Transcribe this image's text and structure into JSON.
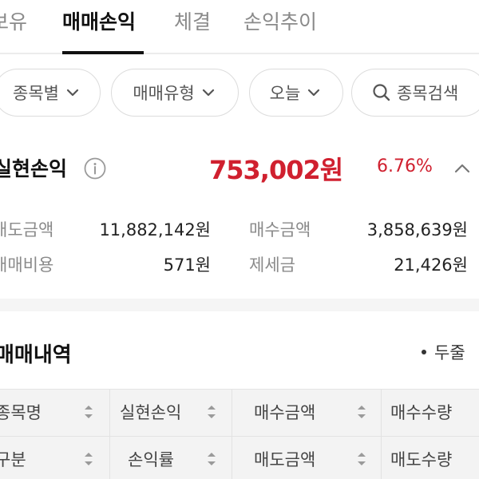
{
  "tabs": [
    {
      "label": "보유"
    },
    {
      "label": "매매손익"
    },
    {
      "label": "체결"
    },
    {
      "label": "손익추이"
    }
  ],
  "filters": {
    "by_stock": "종목별",
    "trade_type": "매매유형",
    "period": "오늘",
    "search": "종목검색"
  },
  "summary": {
    "title": "실현손익",
    "amount": "753,002원",
    "rate": "6.76%",
    "sell_amount_label": "매도금액",
    "sell_amount_value": "11,882,142원",
    "buy_amount_label": "매수금액",
    "buy_amount_value": "3,858,639원",
    "trade_cost_label": "매매비용",
    "trade_cost_value": "571원",
    "tax_label": "제세금",
    "tax_value": "21,426원"
  },
  "trades": {
    "title": "매매내역",
    "more_label": "두줄",
    "columns_row1": [
      "종목명",
      "실현손익",
      "매수금액",
      "매수수량"
    ],
    "columns_row2": [
      "구분",
      "손익률",
      "매도금액",
      "매도수량"
    ]
  },
  "colors": {
    "profit": "#d0202f",
    "text_muted": "#8a8a8a",
    "active_tab": "#111111"
  }
}
